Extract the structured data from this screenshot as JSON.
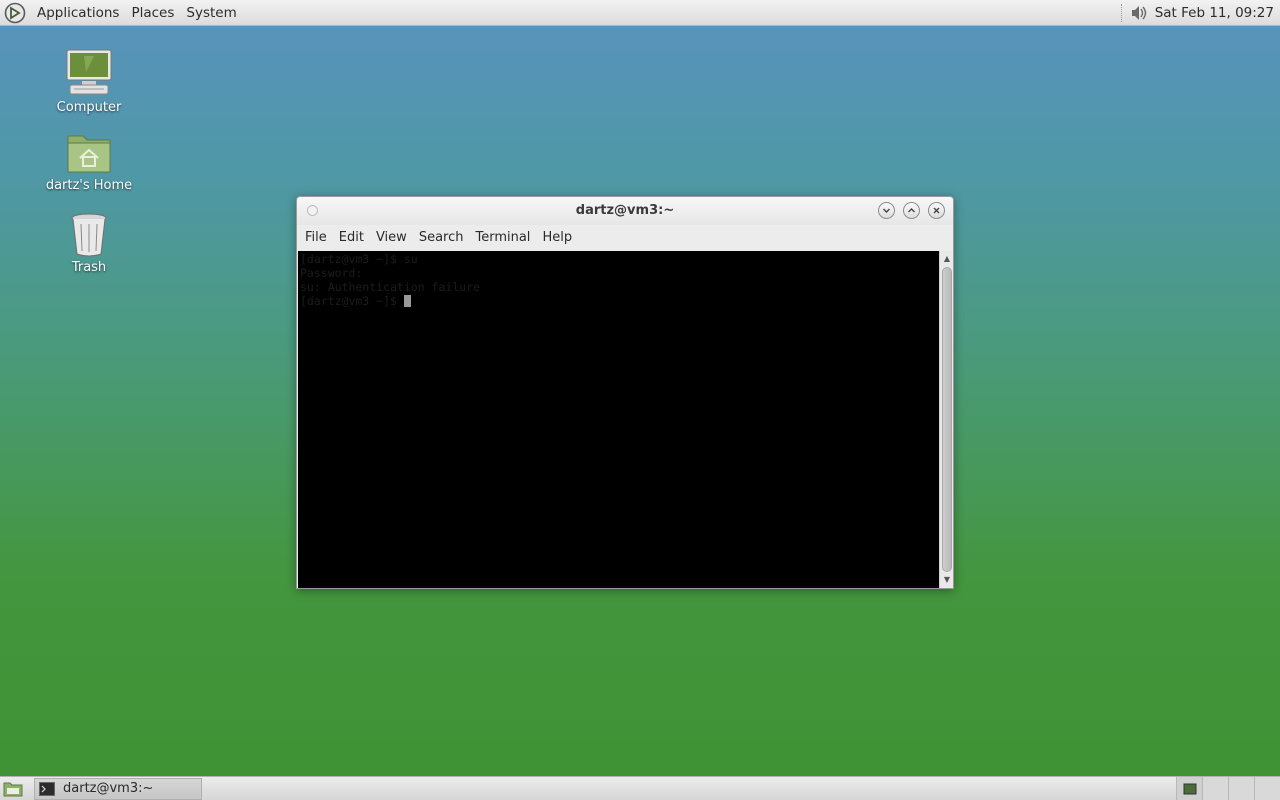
{
  "top_panel": {
    "menus": [
      "Applications",
      "Places",
      "System"
    ],
    "clock": "Sat Feb 11, 09:27",
    "icons": {
      "logo": "mate-logo-icon",
      "volume": "volume-icon"
    }
  },
  "desktop": {
    "icons": [
      {
        "label": "Computer",
        "icon": "computer-icon"
      },
      {
        "label": "dartz's Home",
        "icon": "home-folder-icon"
      },
      {
        "label": "Trash",
        "icon": "trash-icon"
      }
    ]
  },
  "window": {
    "title": "dartz@vm3:~",
    "menu": [
      "File",
      "Edit",
      "View",
      "Search",
      "Terminal",
      "Help"
    ],
    "terminal_lines": [
      "[dartz@vm3 ~]$ su",
      "Password:",
      "su: Authentication failure",
      "[dartz@vm3 ~]$ "
    ],
    "buttons": [
      "minimize",
      "maximize",
      "close"
    ]
  },
  "bottom_panel": {
    "task_label": "dartz@vm3:~",
    "workspaces": 4,
    "active_workspace": 1
  },
  "colors": {
    "terminal_bg": "#000000",
    "terminal_text": "#1c1c1c",
    "desktop_top": "#5a92bf",
    "desktop_bottom": "#3f9232"
  }
}
